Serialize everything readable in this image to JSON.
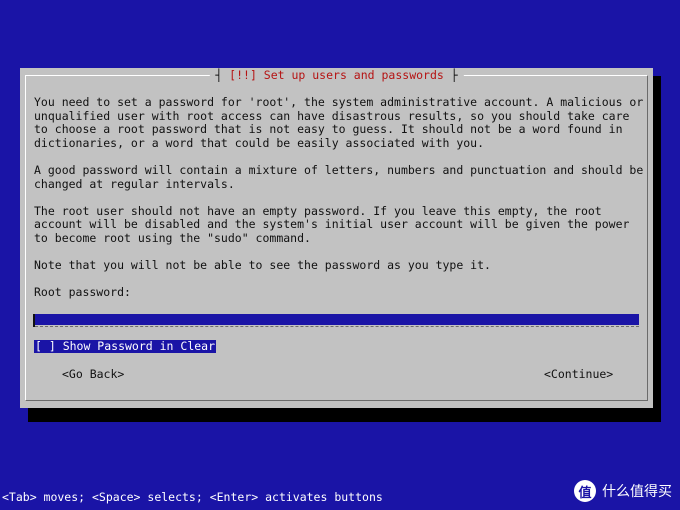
{
  "dialog": {
    "title": "[!!] Set up users and passwords",
    "paragraphs": [
      "You need to set a password for 'root', the system administrative account. A malicious or unqualified user with root access can have disastrous results, so you should take care to choose a root password that is not easy to guess. It should not be a word found in dictionaries, or a word that could be easily associated with you.",
      "A good password will contain a mixture of letters, numbers and punctuation and should be changed at regular intervals.",
      "The root user should not have an empty password. If you leave this empty, the root account will be disabled and the system's initial user account will be given the power to become root using the \"sudo\" command.",
      "Note that you will not be able to see the password as you type it."
    ],
    "password_label": "Root password:",
    "password_value": "",
    "show_password_label": "[ ] Show Password in Clear",
    "go_back_label": "<Go Back>",
    "continue_label": "<Continue>"
  },
  "status_bar": "<Tab> moves; <Space> selects; <Enter> activates buttons",
  "watermark": {
    "icon_text": "值",
    "text": "什么值得买"
  },
  "colors": {
    "background": "#1a14a6",
    "dialog": "#c2c2c2",
    "title": "#b51313"
  }
}
